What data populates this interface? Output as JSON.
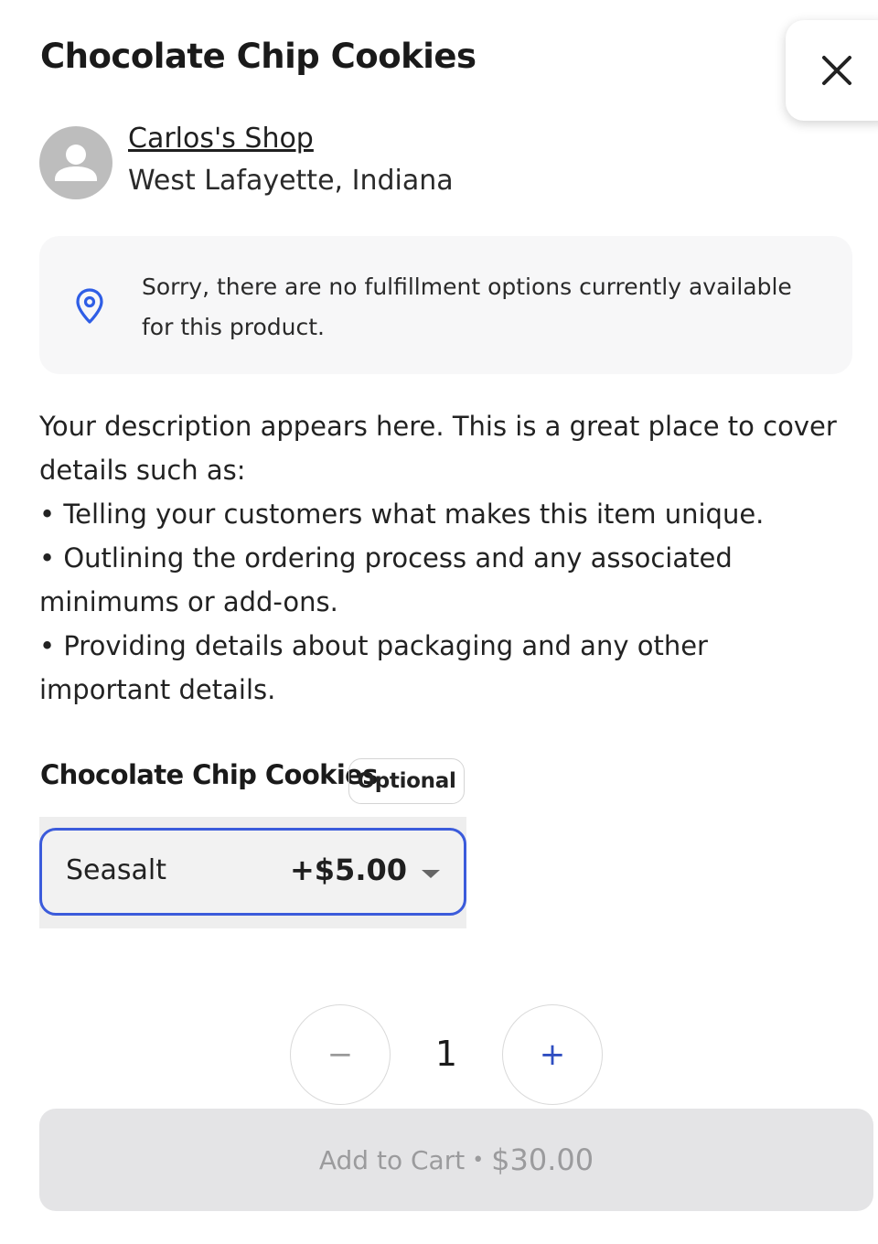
{
  "product": {
    "title": "Chocolate Chip Cookies"
  },
  "close": {
    "icon": "close-icon"
  },
  "shop": {
    "avatar_icon": "person-icon",
    "name": "Carlos's Shop",
    "location": "West Lafayette, Indiana"
  },
  "notice": {
    "icon": "map-pin-icon",
    "text": "Sorry, there are no fulfillment options currently available for this product."
  },
  "description": {
    "lines": [
      "Your description appears here. This is a great place to cover details such as:",
      "• Telling your customers what makes this item unique.",
      "• Outlining the ordering process and any associated minimums or add-ons.",
      "• Providing details about packaging and any other important details."
    ]
  },
  "option": {
    "title": "Chocolate Chip Cookies",
    "badge": "Optional",
    "selected_value": "Seasalt",
    "selected_price": "+$5.00",
    "caret_icon": "caret-down-icon"
  },
  "quantity": {
    "minus_label": "−",
    "value": "1",
    "plus_label": "+"
  },
  "cart": {
    "label": "Add to Cart",
    "separator": "•",
    "price": "$30.00"
  },
  "colors": {
    "accent": "#3b5bdb",
    "pin": "#2f5ee6",
    "notice_bg": "#f7f7f8",
    "button_disabled_bg": "#e4e4e6",
    "button_disabled_text": "#9b9b9d"
  }
}
